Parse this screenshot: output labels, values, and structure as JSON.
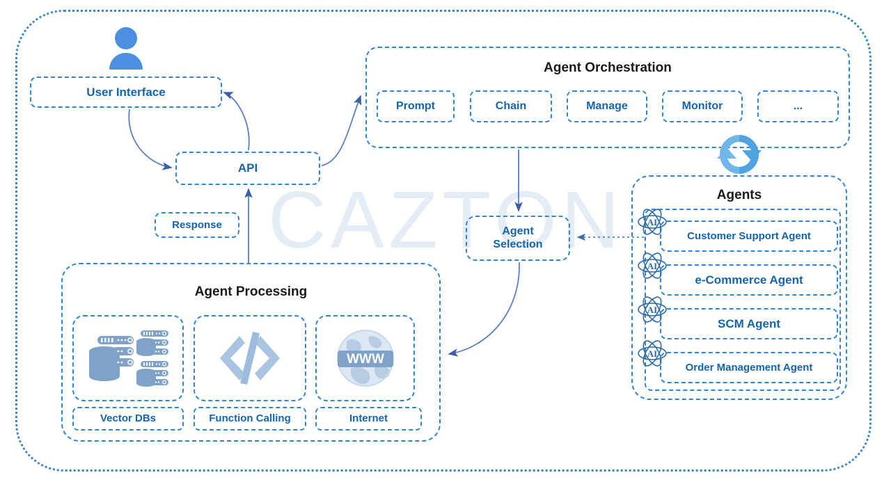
{
  "watermark": {
    "text": "CAZTON"
  },
  "nodes": {
    "user_interface": "User Interface",
    "api": "API",
    "response": "Response",
    "agent_selection": "Agent\nSelection"
  },
  "orchestration": {
    "title": "Agent Orchestration",
    "buttons": [
      {
        "label": "Prompt"
      },
      {
        "label": "Chain"
      },
      {
        "label": "Manage"
      },
      {
        "label": "Monitor"
      },
      {
        "label": "..."
      }
    ]
  },
  "agents": {
    "title": "Agents",
    "items": [
      {
        "label": "Customer Support Agent",
        "icon": "ai-atom-icon"
      },
      {
        "label": "e-Commerce Agent",
        "icon": "ai-atom-icon"
      },
      {
        "label": "SCM Agent",
        "icon": "ai-atom-icon"
      },
      {
        "label": "Order Management Agent",
        "icon": "ai-atom-icon"
      }
    ]
  },
  "processing": {
    "title": "Agent Processing",
    "items": [
      {
        "label": "Vector DBs",
        "icon": "database-stack-icon"
      },
      {
        "label": "Function Calling",
        "icon": "code-brackets-icon"
      },
      {
        "label": "Internet",
        "icon": "globe-www-icon"
      }
    ]
  },
  "icons": {
    "user_avatar": "user-avatar-icon",
    "sync": "sync-refresh-icon"
  },
  "colors": {
    "accent_blue": "#2e86d4",
    "text_blue": "#1564ae",
    "title_black": "#1a1a1a",
    "icon_soft_blue": "#7fa3c8",
    "avatar_blue": "#4a8fe0",
    "watermark": "#e4edf6",
    "arrow_stroke": "#5b7fc4"
  }
}
